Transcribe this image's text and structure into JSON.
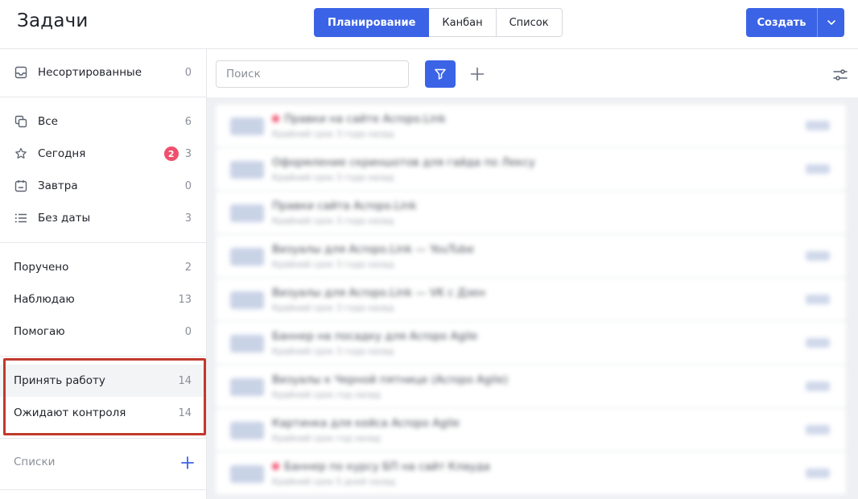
{
  "header": {
    "title": "Задачи",
    "view_tabs": [
      {
        "label": "Планирование",
        "active": true
      },
      {
        "label": "Канбан",
        "active": false
      },
      {
        "label": "Список",
        "active": false
      }
    ],
    "create_label": "Создать"
  },
  "sidebar": {
    "unsorted": {
      "label": "Несортированные",
      "count": "0",
      "icon": "inbox-icon"
    },
    "date_filters": [
      {
        "label": "Все",
        "count": "6",
        "icon": "copy-icon"
      },
      {
        "label": "Сегодня",
        "count": "3",
        "badge": "2",
        "icon": "star-icon"
      },
      {
        "label": "Завтра",
        "count": "0",
        "icon": "calendar-icon"
      },
      {
        "label": "Без даты",
        "count": "3",
        "icon": "list-icon"
      }
    ],
    "role_filters": [
      {
        "label": "Поручено",
        "count": "2"
      },
      {
        "label": "Наблюдаю",
        "count": "13"
      },
      {
        "label": "Помогаю",
        "count": "0"
      }
    ],
    "control_filters": [
      {
        "label": "Принять работу",
        "count": "14"
      },
      {
        "label": "Ожидают контроля",
        "count": "14"
      }
    ],
    "lists_label": "Списки"
  },
  "toolbar": {
    "search_placeholder": "Поиск"
  },
  "tasks": [
    {
      "title": "Правки на сайте Acropo.Link",
      "subtitle": "Крайний срок 3 года назад",
      "urgent": true
    },
    {
      "title": "Оформление скриншотов для гайда по Лексу",
      "subtitle": "Крайний срок 3 года назад",
      "urgent": false
    },
    {
      "title": "Правки сайта Acropo.Link",
      "subtitle": "Крайний срок 3 года назад",
      "urgent": false
    },
    {
      "title": "Визуалы для Acropo.Link — YouTube",
      "subtitle": "Крайний срок 3 года назад",
      "urgent": false
    },
    {
      "title": "Визуалы для Acropo.Link — VK с Дзен",
      "subtitle": "Крайний срок 3 года назад",
      "urgent": false
    },
    {
      "title": "Баннер на посадку для Acropo Agile",
      "subtitle": "Крайний срок 3 года назад",
      "urgent": false
    },
    {
      "title": "Визуалы к Черной пятнице (Acropo Agile)",
      "subtitle": "Крайний срок год назад",
      "urgent": false
    },
    {
      "title": "Картинка для кейса Acropo Agile",
      "subtitle": "Крайний срок год назад",
      "urgent": false
    },
    {
      "title": "Баннер по курсу БП на сайт Клауда",
      "subtitle": "Крайний срок 5 дней назад",
      "urgent": true
    }
  ],
  "colors": {
    "accent": "#3b63e6",
    "badge": "#f0506e",
    "highlight": "#c0392b"
  }
}
